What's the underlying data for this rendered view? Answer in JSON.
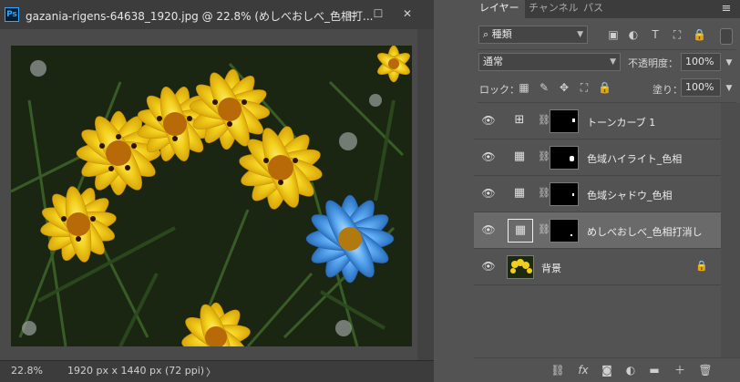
{
  "document": {
    "app_badge": "Ps",
    "title": "gazania-rigens-64638_1920.jpg @ 22.8% (めしべおしべ_色相打...",
    "window_controls": {
      "minimize": "▭",
      "maximize": "☐",
      "close": "✕"
    },
    "status": {
      "zoom": "22.8%",
      "dimensions": "1920 px x 1440 px (72 ppi)",
      "arrow": "〉"
    }
  },
  "layers_panel": {
    "tabs": [
      {
        "label": "レイヤー",
        "active": true
      },
      {
        "label": "チャンネル",
        "active": false
      },
      {
        "label": "パス",
        "active": false
      }
    ],
    "menu_icon": "≡",
    "filter": {
      "search_icon": "⌕",
      "kind_value": "種類",
      "icons": [
        "▣",
        "◐",
        "T",
        "⛶",
        "🔒"
      ]
    },
    "blend_mode": "通常",
    "opacity": {
      "label": "不透明度：",
      "value": "100%"
    },
    "lock": {
      "label": "ロック：",
      "icons": [
        "▦",
        "✎",
        "✥",
        "⛶",
        "🔒"
      ]
    },
    "fill": {
      "label": "塗り：",
      "value": "100%"
    },
    "layers": [
      {
        "name": "トーンカーブ 1",
        "icon": "⊞",
        "selected": false,
        "has_mask": true
      },
      {
        "name": "色域ハイライト_色相",
        "icon": "▦",
        "selected": false,
        "has_mask": true
      },
      {
        "name": "色域シャドウ_色相",
        "icon": "▦",
        "selected": false,
        "has_mask": true
      },
      {
        "name": "めしべおしべ_色相打消し",
        "icon": "▦",
        "selected": true,
        "has_mask": true
      },
      {
        "name": "背景",
        "icon": "",
        "selected": false,
        "has_mask": false,
        "locked": true
      }
    ],
    "bottom_icons": [
      "⛓",
      "fx",
      "◙",
      "◐",
      "▬",
      "＋",
      "🗑"
    ]
  }
}
